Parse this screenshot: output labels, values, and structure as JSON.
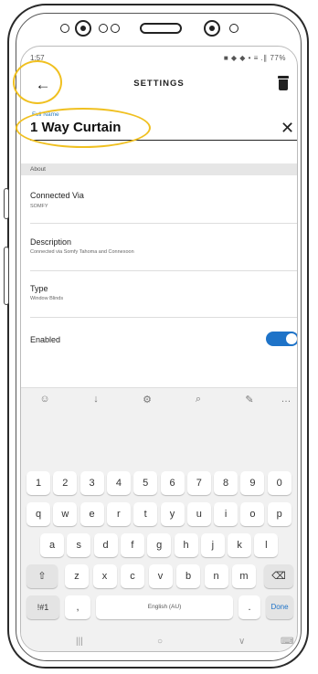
{
  "status_bar": {
    "time": "1:57",
    "icons_right": "■ ◆ ◆ • ≡ .∥ 77%"
  },
  "app_bar": {
    "title": "SETTINGS",
    "back_icon": "←"
  },
  "name_field": {
    "label": "Full Name",
    "value": "1 Way Curtain",
    "clear_icon": "✕"
  },
  "section": {
    "title": "About"
  },
  "details": [
    {
      "title": "Connected Via",
      "subtitle": "SOMFY"
    },
    {
      "title": "Description",
      "subtitle": "Connected via Somfy Tahoma and Connexoon"
    },
    {
      "title": "Type",
      "subtitle": "Window Blinds"
    }
  ],
  "enabled": {
    "label": "Enabled",
    "value": true
  },
  "keyboard": {
    "toolbar": [
      "☺",
      "↓",
      "⚙",
      "⌕",
      "✎",
      "…"
    ],
    "row_numbers": [
      "1",
      "2",
      "3",
      "4",
      "5",
      "6",
      "7",
      "8",
      "9",
      "0"
    ],
    "row_1": [
      "q",
      "w",
      "e",
      "r",
      "t",
      "y",
      "u",
      "i",
      "o",
      "p"
    ],
    "row_2": [
      "a",
      "s",
      "d",
      "f",
      "g",
      "h",
      "j",
      "k",
      "l"
    ],
    "row_3": [
      "z",
      "x",
      "c",
      "v",
      "b",
      "n",
      "m"
    ],
    "shift_icon": "⇧",
    "backspace_icon": "⌫",
    "symbols_label": "!#1",
    "comma_label": ",",
    "space_label": "English (AU)",
    "period_label": ".",
    "done_label": "Done"
  },
  "nav_bar": {
    "recents": "|||",
    "home": "○",
    "back": "∨",
    "keyboard": "⌨"
  },
  "colors": {
    "accent": "#1e73c8",
    "highlight": "#f0c020",
    "label_blue": "#2b7bbd"
  }
}
